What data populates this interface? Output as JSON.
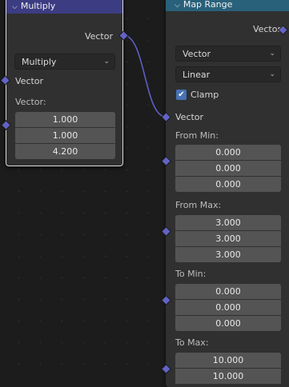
{
  "multiply_node": {
    "title": "Multiply",
    "output_label": "Vector",
    "operation": "Multiply",
    "input_label": "Vector",
    "vector_label": "Vector:",
    "values": [
      "1.000",
      "1.000",
      "4.200"
    ]
  },
  "map_range_node": {
    "title": "Map Range",
    "output_label": "Vector",
    "data_type": "Vector",
    "interpolation": "Linear",
    "clamp_label": "Clamp",
    "clamp_checked": true,
    "input_label": "Vector",
    "from_min": {
      "label": "From Min:",
      "values": [
        "0.000",
        "0.000",
        "0.000"
      ]
    },
    "from_max": {
      "label": "From Max:",
      "values": [
        "3.000",
        "3.000",
        "3.000"
      ]
    },
    "to_min": {
      "label": "To Min:",
      "values": [
        "0.000",
        "0.000",
        "0.000"
      ]
    },
    "to_max": {
      "label": "To Max:",
      "values": [
        "10.000",
        "10.000"
      ]
    }
  },
  "colors": {
    "multiply_header": "#3c3c83",
    "map_range_header": "#29617a",
    "vector_socket": "#6363c7",
    "checkbox": "#4772b3"
  },
  "icons": {
    "collapse": "chevron-down-icon",
    "dropdown": "chevron-down-icon",
    "check": "checkmark-icon"
  }
}
